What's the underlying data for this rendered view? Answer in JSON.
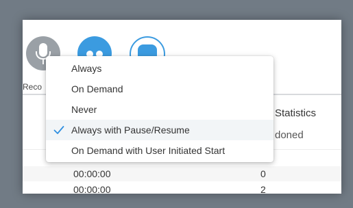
{
  "toolbar": {
    "record_label": "Reco"
  },
  "table": {
    "column_header": "Statistics",
    "top_cell": "doned",
    "rows": [
      {
        "time": "00:00:00",
        "value": "0"
      },
      {
        "time": "00:00:00",
        "value": "2"
      }
    ]
  },
  "dropdown": {
    "selected_index": 3,
    "items": [
      {
        "label": "Always"
      },
      {
        "label": "On Demand"
      },
      {
        "label": "Never"
      },
      {
        "label": "Always with Pause/Resume"
      },
      {
        "label": "On Demand with User Initiated Start"
      }
    ]
  },
  "colors": {
    "accent": "#3b9be0",
    "check": "#2f8fe0",
    "backdrop": "#717b85"
  }
}
